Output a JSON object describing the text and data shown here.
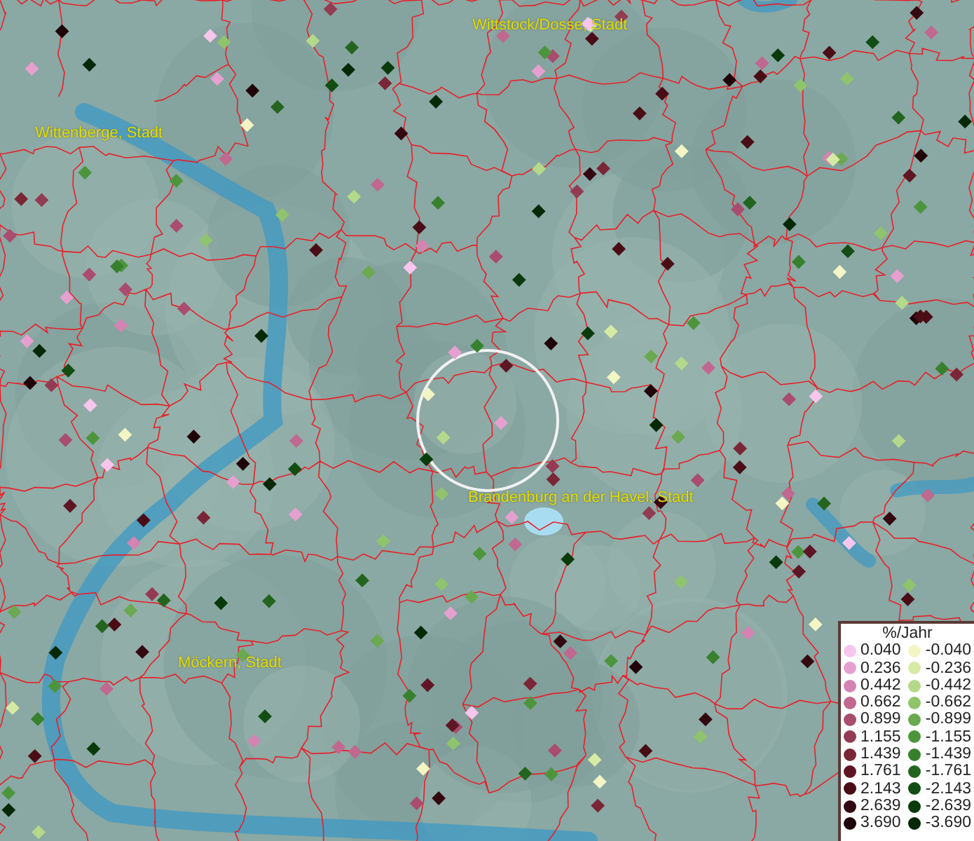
{
  "places": [
    {
      "name": "Wittstock/Dosse, Stadt"
    },
    {
      "name": "Wittenberge, Stadt"
    },
    {
      "name": "Brandenburg an der Havel, Stadt"
    },
    {
      "name": "Möckern, Stadt"
    }
  ],
  "legend": {
    "title": "%/Jahr",
    "entries": [
      {
        "label": "0.040",
        "color": "#f7c6ec"
      },
      {
        "label": "-0.040",
        "color": "#f3f5c5"
      },
      {
        "label": "0.236",
        "color": "#e6a0cf"
      },
      {
        "label": "-0.236",
        "color": "#d7eaa4"
      },
      {
        "label": "0.442",
        "color": "#d484b2"
      },
      {
        "label": "-0.442",
        "color": "#b4d98a"
      },
      {
        "label": "0.662",
        "color": "#c0688f"
      },
      {
        "label": "-0.662",
        "color": "#8fc46c"
      },
      {
        "label": "0.899",
        "color": "#a94c6e"
      },
      {
        "label": "-0.899",
        "color": "#6aa94f"
      },
      {
        "label": "1.155",
        "color": "#933b52"
      },
      {
        "label": "-1.155",
        "color": "#4c953c"
      },
      {
        "label": "1.439",
        "color": "#7a2636"
      },
      {
        "label": "-1.439",
        "color": "#37812e"
      },
      {
        "label": "1.761",
        "color": "#5e1624"
      },
      {
        "label": "-1.761",
        "color": "#23651e"
      },
      {
        "label": "2.143",
        "color": "#4a0d16"
      },
      {
        "label": "-2.143",
        "color": "#124d13"
      },
      {
        "label": "2.639",
        "color": "#340810"
      },
      {
        "label": "-2.639",
        "color": "#0a3a0c"
      },
      {
        "label": "3.690",
        "color": "#200308"
      },
      {
        "label": "-3.690",
        "color": "#052807"
      }
    ]
  }
}
